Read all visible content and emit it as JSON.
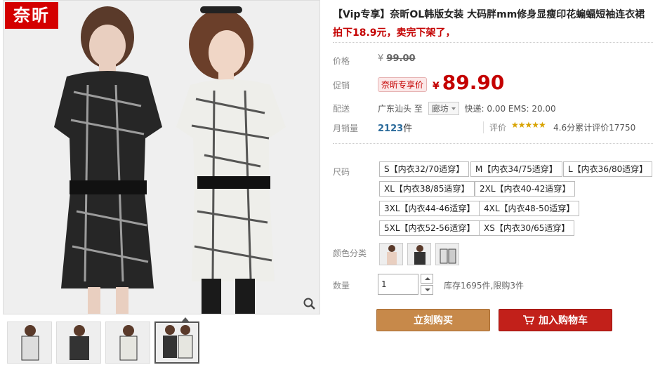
{
  "gallery": {
    "logo_text": "奈昕",
    "thumbnails": [
      "thumb-1",
      "thumb-2",
      "thumb-3",
      "thumb-4"
    ],
    "active_thumbnail": 4
  },
  "product": {
    "title": "【Vip专享】奈昕OL韩版女装 大码胖mm修身显瘦印花蝙蝠短袖连衣裙",
    "subtitle": "拍下18.9元，卖完下架了，"
  },
  "price": {
    "label": "价格",
    "currency": "¥",
    "original": "99.00"
  },
  "promo": {
    "label": "促销",
    "tag": "奈昕专享价",
    "currency": "¥",
    "price": "89.90"
  },
  "shipping": {
    "label": "配送",
    "from": "广东汕头",
    "to_word": "至",
    "destination": "廊坊",
    "fees": "快递: 0.00 EMS: 20.00"
  },
  "sales": {
    "label": "月销量",
    "count": "2123",
    "unit": "件",
    "rating_label": "评价",
    "stars": "★★★★★",
    "rating_text": "4.6分累计评价17750"
  },
  "size": {
    "label": "尺码",
    "options": [
      "S【内衣32/70适穿】",
      "M【内衣34/75适穿】",
      "L【内衣36/80适穿】",
      "XL【内衣38/85适穿】",
      "2XL【内衣40-42适穿】",
      "3XL【内衣44-46适穿】",
      "4XL【内衣48-50适穿】",
      "5XL【内衣52-56适穿】",
      "XS【内衣30/65适穿】"
    ]
  },
  "color": {
    "label": "颜色分类",
    "options": [
      "color-swatch-1",
      "color-swatch-2",
      "color-swatch-3"
    ]
  },
  "quantity": {
    "label": "数量",
    "value": "1",
    "stock": "库存1695件,限购3件"
  },
  "actions": {
    "buy_now": "立刻购买",
    "add_to_cart": "加入购物车"
  },
  "colors": {
    "accent_red": "#c40000",
    "buy_button": "#c7894a",
    "cart_button": "#c2201a"
  }
}
